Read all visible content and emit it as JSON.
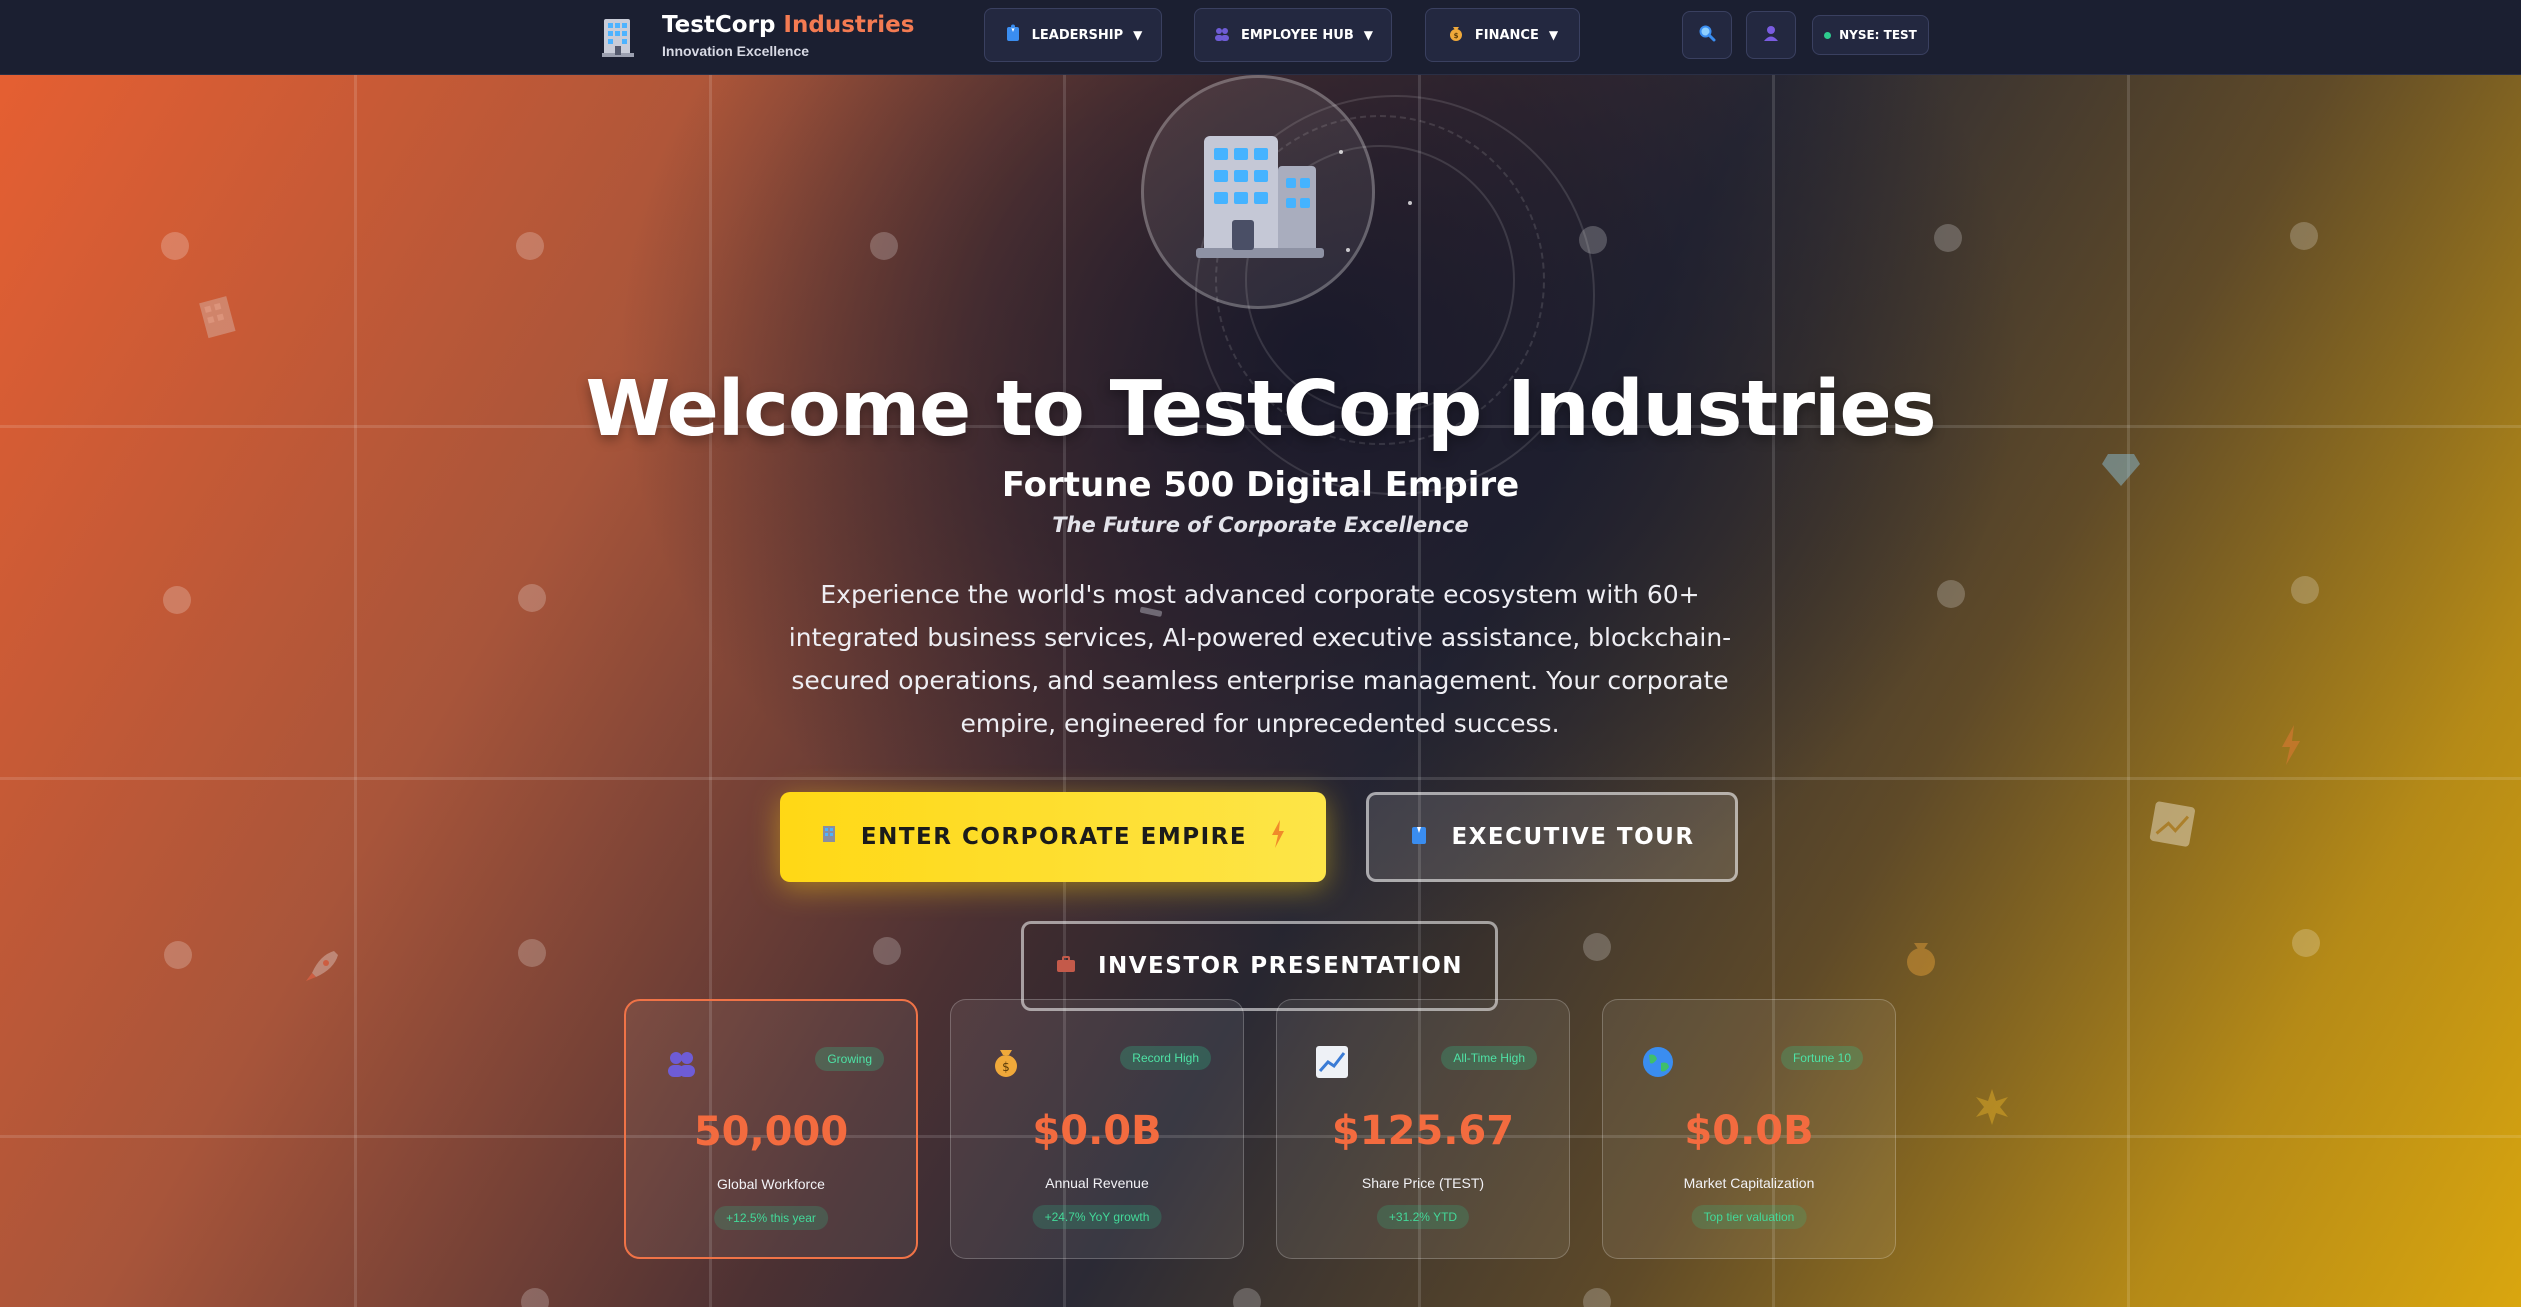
{
  "brand": {
    "name_main": "TestCorp",
    "name_accent": "Industries",
    "tagline": "Innovation Excellence",
    "icon": "office-building-icon"
  },
  "nav": {
    "items": [
      {
        "label": "LEADERSHIP",
        "icon": "suit-person-icon"
      },
      {
        "label": "EMPLOYEE HUB",
        "icon": "people-icon"
      },
      {
        "label": "FINANCE",
        "icon": "money-bag-icon"
      }
    ],
    "search_icon": "search-icon",
    "user_icon": "user-icon",
    "ticker_label": "NYSE: TEST"
  },
  "hero": {
    "title": "Welcome to TestCorp Industries",
    "subtitle": "Fortune 500 Digital Empire",
    "tagline": "The Future of Corporate Excellence",
    "description": "Experience the world's most advanced corporate ecosystem with 60+ integrated business services, AI-powered executive assistance, blockchain-secured operations, and seamless enterprise management. Your corporate empire, engineered for unprecedented success.",
    "cta_primary": "ENTER CORPORATE EMPIRE",
    "cta_secondary": "EXECUTIVE TOUR",
    "cta_tertiary": "INVESTOR PRESENTATION"
  },
  "stats": [
    {
      "value": "50,000",
      "label": "Global Workforce",
      "badge": "Growing",
      "trend": "+12.5% this year",
      "icon": "people-icon"
    },
    {
      "value": "$0.0B",
      "label": "Annual Revenue",
      "badge": "Record High",
      "trend": "+24.7% YoY growth",
      "icon": "money-bag-icon"
    },
    {
      "value": "$125.67",
      "label": "Share Price (TEST)",
      "badge": "All-Time High",
      "trend": "+31.2% YTD",
      "icon": "chart-up-icon"
    },
    {
      "value": "$0.0B",
      "label": "Market Capitalization",
      "badge": "Fortune 10",
      "trend": "Top tier valuation",
      "icon": "globe-icon"
    }
  ],
  "colors": {
    "accent_orange": "#f36b3f",
    "cta_yellow": "#ffd815",
    "nav_bg": "#1b1f31",
    "badge_green": "#2ecc8f"
  }
}
